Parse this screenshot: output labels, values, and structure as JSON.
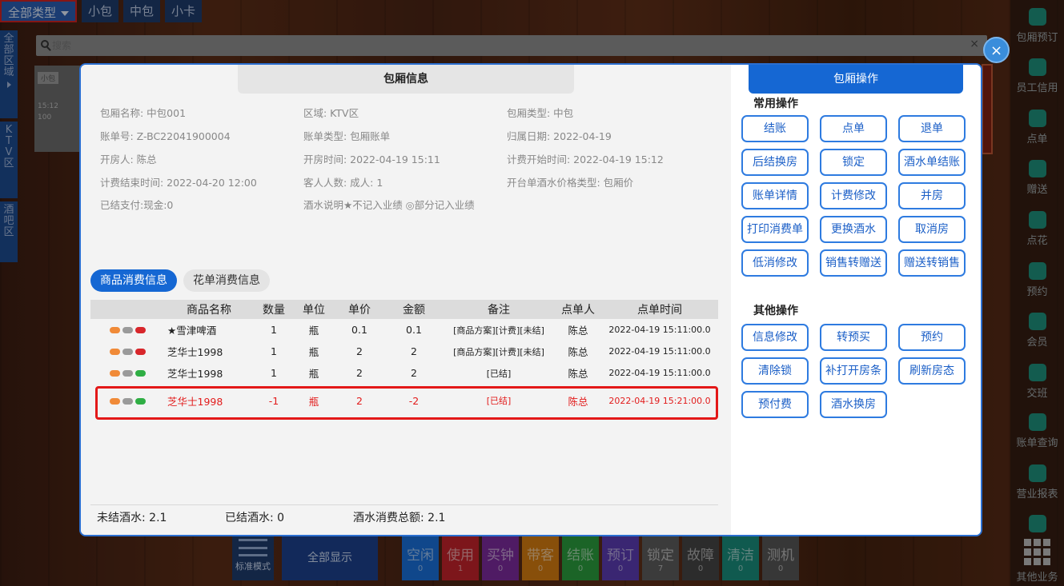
{
  "top_tabs": [
    {
      "label": "全部类型"
    },
    {
      "label": "小包"
    },
    {
      "label": "中包"
    },
    {
      "label": "小卡"
    }
  ],
  "zones": [
    "全部区域",
    "KTV区",
    "酒吧区"
  ],
  "search": {
    "placeholder": "搜索",
    "clear": "×"
  },
  "room_tile": {
    "name": "小包",
    "time": "15:12",
    "num": "100"
  },
  "right_bar": [
    {
      "label": "包厢预订",
      "icon": "booking-icon"
    },
    {
      "label": "员工信用",
      "icon": "credit-icon"
    },
    {
      "label": "点单",
      "icon": "order-icon"
    },
    {
      "label": "赠送",
      "icon": "gift-icon"
    },
    {
      "label": "点花",
      "icon": "flower-icon"
    },
    {
      "label": "预约",
      "icon": "appointment-icon"
    },
    {
      "label": "会员",
      "icon": "member-icon"
    },
    {
      "label": "交班",
      "icon": "shift-icon"
    },
    {
      "label": "账单查询",
      "icon": "bill-query-icon"
    },
    {
      "label": "营业报表",
      "icon": "report-icon"
    },
    {
      "label": "",
      "icon": "misc-icon"
    },
    {
      "label": "其他业务",
      "icon": "grid-icon"
    }
  ],
  "bottom_bar": {
    "mode_label": "标准模式",
    "show_all": "全部显示",
    "statuses": [
      {
        "label": "空闲",
        "count": "0",
        "color": "#1a6ed6"
      },
      {
        "label": "使用",
        "count": "1",
        "color": "#c0232a"
      },
      {
        "label": "买钟",
        "count": "0",
        "color": "#7a2a9a"
      },
      {
        "label": "带客",
        "count": "0",
        "color": "#d27a10"
      },
      {
        "label": "结账",
        "count": "0",
        "color": "#2a9a3c"
      },
      {
        "label": "预订",
        "count": "0",
        "color": "#5a3bb0"
      },
      {
        "label": "锁定",
        "count": "7",
        "color": "#5b5b5b"
      },
      {
        "label": "故障",
        "count": "0",
        "color": "#444444"
      },
      {
        "label": "清洁",
        "count": "0",
        "color": "#1a8a7a"
      },
      {
        "label": "测机",
        "count": "0",
        "color": "#555555"
      }
    ]
  },
  "modal": {
    "close": "×",
    "info_title": "包厢信息",
    "info": {
      "room_name": "包厢名称: 中包001",
      "area": "区域: KTV区",
      "room_type": "包厢类型: 中包",
      "bill_no": "账单号: Z-BC22041900004",
      "bill_type": "账单类型: 包厢账单",
      "belong_date": "归属日期: 2022-04-19",
      "opener": "开房人: 陈总",
      "open_time": "开房时间: 2022-04-19 15:11",
      "charge_start": "计费开始时间: 2022-04-19 15:12",
      "charge_end": "计费结束时间: 2022-04-20 12:00",
      "guests": "客人人数: 成人: 1",
      "price_type": "开台单酒水价格类型: 包厢价",
      "paid": "已结支付:现金:0",
      "note": "酒水说明★不记入业绩 ◎部分记入业绩"
    },
    "tabs": [
      {
        "label": "商品消费信息",
        "active": true
      },
      {
        "label": "花单消费信息",
        "active": false
      }
    ],
    "table": {
      "headers": [
        "",
        "商品名称",
        "数量",
        "单位",
        "单价",
        "金额",
        "备注",
        "点单人",
        "点单时间"
      ],
      "rows": [
        {
          "badges": [
            "o",
            "g",
            "r"
          ],
          "name": "★雪津啤酒",
          "qty": "1",
          "unit": "瓶",
          "price": "0.1",
          "amount": "0.1",
          "remark": "[商品方案][计费][未结]",
          "orderer": "陈总",
          "time": "2022-04-19 15:11:00.0"
        },
        {
          "badges": [
            "o",
            "g",
            "r"
          ],
          "name": "芝华士1998",
          "qty": "1",
          "unit": "瓶",
          "price": "2",
          "amount": "2",
          "remark": "[商品方案][计费][未结]",
          "orderer": "陈总",
          "time": "2022-04-19 15:11:00.0"
        },
        {
          "badges": [
            "o",
            "g",
            "gr"
          ],
          "name": "芝华士1998",
          "qty": "1",
          "unit": "瓶",
          "price": "2",
          "amount": "2",
          "remark": "[已结]",
          "orderer": "陈总",
          "time": "2022-04-19 15:11:00.0"
        },
        {
          "badges": [
            "o",
            "g",
            "gr"
          ],
          "name": "芝华士1998",
          "qty": "-1",
          "unit": "瓶",
          "price": "2",
          "amount": "-2",
          "remark": "[已结]",
          "orderer": "陈总",
          "time": "2022-04-19 15:21:00.0"
        }
      ]
    },
    "summary": {
      "unsettled": "未结酒水: 2.1",
      "settled": "已结酒水: 0",
      "total": "酒水消费总额: 2.1"
    },
    "ops": {
      "title": "包厢操作",
      "common_label": "常用操作",
      "common": [
        "结账",
        "点单",
        "退单",
        "后结换房",
        "锁定",
        "酒水单结账",
        "账单详情",
        "计费修改",
        "并房",
        "打印消费单",
        "更换酒水",
        "取消房",
        "低消修改",
        "销售转赠送",
        "赠送转销售"
      ],
      "other_label": "其他操作",
      "other": [
        "信息修改",
        "转预买",
        "预约",
        "清除锁",
        "补打开房条",
        "刷新房态",
        "预付费",
        "酒水换房"
      ]
    }
  }
}
